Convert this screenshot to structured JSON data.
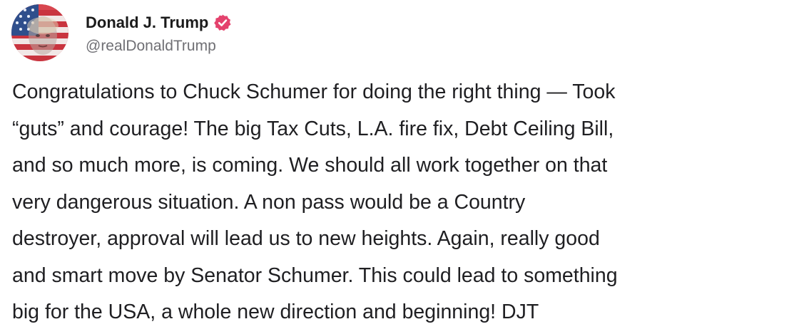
{
  "author": {
    "display_name": "Donald J. Trump",
    "handle": "@realDonaldTrump",
    "verified_icon": "verified-badge-icon",
    "verified_color": "#e4426d",
    "avatar_icon": "profile-avatar-flag"
  },
  "post": {
    "lines": [
      "Congratulations to Chuck Schumer for doing the right thing — Took",
      "“guts” and courage! The big Tax Cuts, L.A. fire fix, Debt Ceiling Bill,",
      "and so much more, is coming. We should all work together on that",
      "very dangerous situation. A non pass would be a Country",
      "destroyer, approval will lead us to new heights. Again, really good",
      "and smart move by Senator Schumer. This could lead to something",
      "big for the USA, a whole new direction and beginning! DJT"
    ]
  }
}
